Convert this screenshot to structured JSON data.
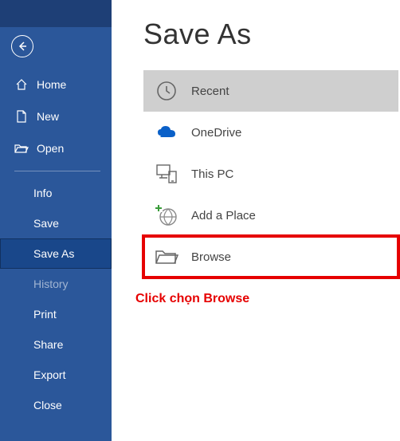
{
  "sidebar": {
    "nav_primary": [
      {
        "label": "Home"
      },
      {
        "label": "New"
      },
      {
        "label": "Open"
      }
    ],
    "nav_secondary": [
      {
        "label": "Info"
      },
      {
        "label": "Save"
      },
      {
        "label": "Save As",
        "selected": true
      },
      {
        "label": "History",
        "disabled": true
      },
      {
        "label": "Print"
      },
      {
        "label": "Share"
      },
      {
        "label": "Export"
      },
      {
        "label": "Close"
      }
    ]
  },
  "content": {
    "title": "Save As",
    "locations": [
      {
        "label": "Recent",
        "selected": true
      },
      {
        "label": "OneDrive"
      },
      {
        "label": "This PC"
      },
      {
        "label": "Add a Place"
      },
      {
        "label": "Browse",
        "highlighted": true
      }
    ],
    "annotation": "Click chọn Browse"
  }
}
